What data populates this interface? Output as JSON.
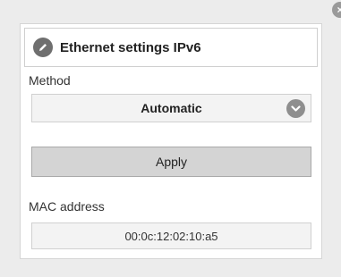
{
  "dialog": {
    "close_glyph": "×",
    "title": "Ethernet settings IPv6",
    "title_icon": "pencil-icon"
  },
  "method": {
    "label": "Method",
    "selected": "Automatic"
  },
  "apply_label": "Apply",
  "mac": {
    "label": "MAC address",
    "value": "00:0c:12:02:10:a5"
  }
}
